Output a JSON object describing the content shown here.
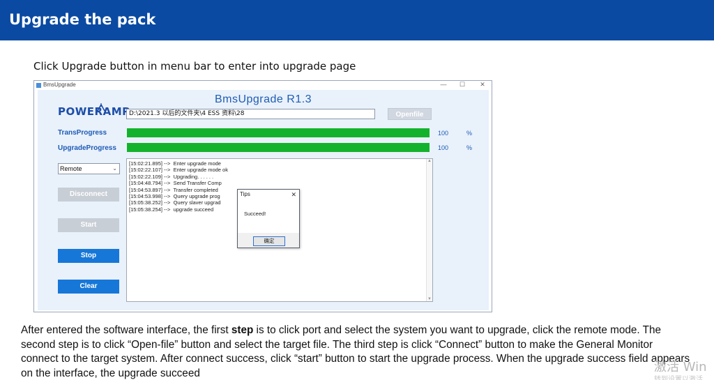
{
  "slide": {
    "title": "Upgrade the pack",
    "intro": "Click Upgrade button in menu bar to enter into upgrade page",
    "description": {
      "part1": "After entered the software interface, the first ",
      "bold": "step",
      "part2": " is to click  port and select the system you want to upgrade, click the remote mode. The second step is to click “Open-file” button and select the target file. The third step is click “Connect” button to make the General Monitor connect to the target system. After connect success, click “start” button to start the upgrade process. When the upgrade success field appears on the interface, the upgrade succeed"
    },
    "watermark": "激活 Win",
    "watermark_sub": "转到设置以激活"
  },
  "window": {
    "title": "BmsUpgrade",
    "minimize": "—",
    "maximize": "☐",
    "close": "✕",
    "app_title": "BmsUpgrade R1.3",
    "logo": "POWERAMP",
    "file_path": "D:\\2021.3 以后的文件夹\\4 ESS 资料\\28",
    "openfile_label": "Openfile",
    "trans_progress_label": "TransProgress",
    "trans_progress_value": "100",
    "trans_progress_fraction": 1.0,
    "upgrade_progress_label": "UpgradeProgress",
    "upgrade_progress_value": "100",
    "upgrade_progress_fraction": 1.0,
    "percent_unit": "%",
    "mode_selected": "Remote",
    "buttons": {
      "disconnect": "Disconnect",
      "start": "Start",
      "stop": "Stop",
      "clear": "Clear"
    },
    "log_text": "[15:02:21.895] -->  Enter upgrade mode\n[15:02:22.107] -->  Enter upgrade mode ok\n[15:02:22.109] -->  Upgrading. . . . . .\n[15:04:48.794] -->  Send Transfer Comp\n[15:04:53.897] -->  Transfer completed\n[15:04:53.998] -->  Query upgrade prog\n[15:05:38.252] -->  Query slaver upgrad\n[15:05:38.254] -->  upgrade succeed"
  },
  "dialog": {
    "title": "Tips",
    "close": "✕",
    "message": "Succeed!",
    "ok_label": "确定"
  },
  "colors": {
    "header": "#0a4aa2",
    "progress_fill": "#13b22c",
    "primary_button": "#1677d8",
    "disabled_button": "#c8ced6",
    "accent_text": "#1d5bb5"
  }
}
